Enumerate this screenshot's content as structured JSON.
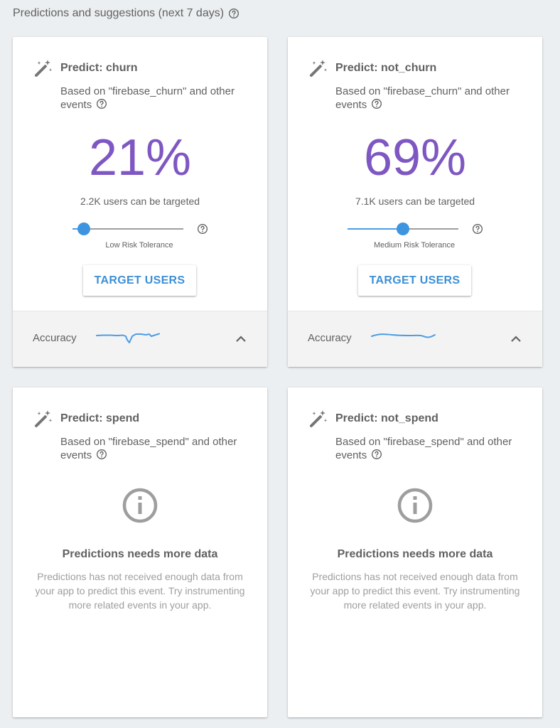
{
  "header": {
    "title": "Predictions and suggestions (next 7 days)"
  },
  "icons": {
    "wand": "magic-wand-icon",
    "help": "help-circle-icon",
    "info": "info-circle-icon",
    "expand": "chevron-up-icon"
  },
  "colors": {
    "accent_purple": "#7e57c2",
    "accent_blue": "#3c8fd6",
    "background": "#eceff1"
  },
  "cards": [
    {
      "title": "Predict: churn",
      "based_on": "Based on \"firebase_churn\" and other events",
      "percent": "21%",
      "targeted": "2.2K users can be targeted",
      "risk_tolerance": "Low Risk Tolerance",
      "slider_value": 0.1,
      "button": "TARGET USERS",
      "accuracy_label": "Accuracy"
    },
    {
      "title": "Predict: not_churn",
      "based_on": "Based on \"firebase_churn\" and other events",
      "percent": "69%",
      "targeted": "7.1K users can be targeted",
      "risk_tolerance": "Medium Risk Tolerance",
      "slider_value": 0.5,
      "button": "TARGET USERS",
      "accuracy_label": "Accuracy"
    },
    {
      "title": "Predict: spend",
      "based_on": "Based on \"firebase_spend\" and other events",
      "nodata_title": "Predictions needs more data",
      "nodata_desc": "Predictions has not received enough data from your app to predict this event. Try instrumenting more related events in your app."
    },
    {
      "title": "Predict: not_spend",
      "based_on": "Based on \"firebase_spend\" and other events",
      "nodata_title": "Predictions needs more data",
      "nodata_desc": "Predictions has not received enough data from your app to predict this event. Try instrumenting more related events in your app."
    }
  ]
}
